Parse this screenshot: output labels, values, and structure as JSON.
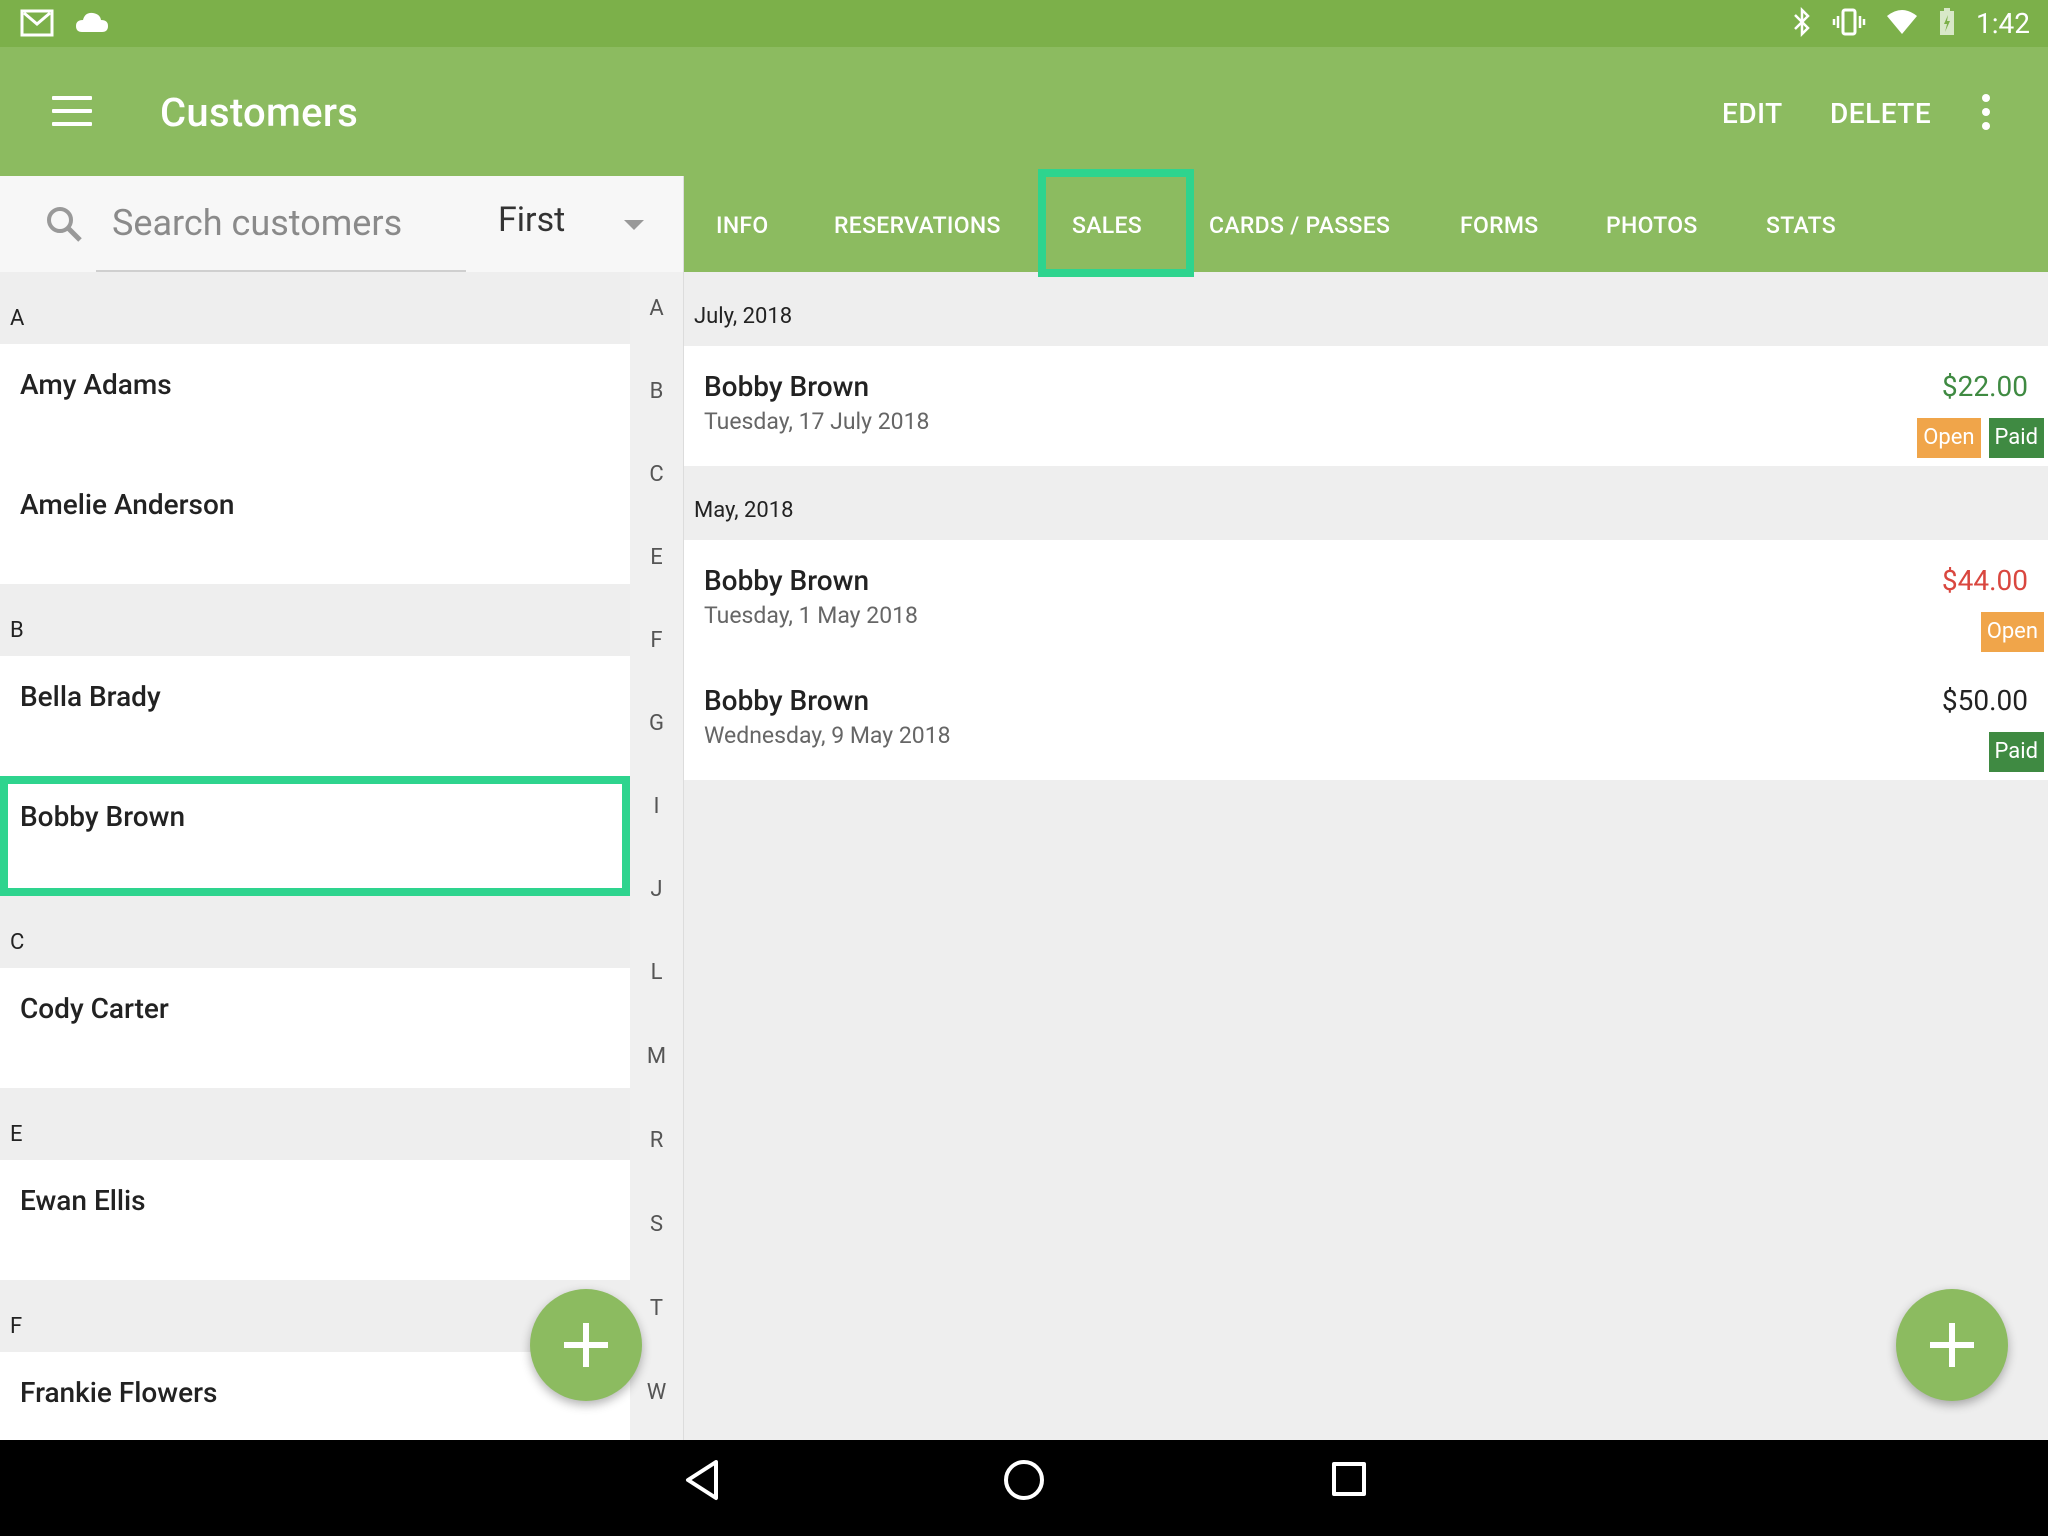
{
  "status_bar": {
    "time": "1:42"
  },
  "app_bar": {
    "title": "Customers",
    "actions": {
      "edit": "EDIT",
      "delete": "DELETE"
    }
  },
  "search": {
    "placeholder": "Search customers",
    "sort_value": "First"
  },
  "customers": {
    "sections": [
      {
        "letter": "A",
        "items": [
          "Amy Adams",
          "Amelie Anderson"
        ]
      },
      {
        "letter": "B",
        "items": [
          "Bella Brady",
          "Bobby Brown"
        ]
      },
      {
        "letter": "C",
        "items": [
          "Cody Carter"
        ]
      },
      {
        "letter": "E",
        "items": [
          "Ewan Ellis"
        ]
      },
      {
        "letter": "F",
        "items": [
          "Frankie Flowers"
        ]
      }
    ],
    "selected": "Bobby Brown"
  },
  "index_letters": [
    "A",
    "B",
    "C",
    "E",
    "F",
    "G",
    "I",
    "J",
    "L",
    "M",
    "R",
    "S",
    "T",
    "W"
  ],
  "tabs": [
    "INFO",
    "RESERVATIONS",
    "SALES",
    "CARDS / PASSES",
    "FORMS",
    "PHOTOS",
    "STATS"
  ],
  "active_tab": "SALES",
  "sales": {
    "groups": [
      {
        "month": "July, 2018",
        "items": [
          {
            "name": "Bobby Brown",
            "date": "Tuesday, 17 July 2018",
            "amount": "$22.00",
            "amount_color": "#3f8a42",
            "badges": [
              "Open",
              "Paid"
            ]
          }
        ]
      },
      {
        "month": "May, 2018",
        "items": [
          {
            "name": "Bobby Brown",
            "date": "Tuesday, 1 May 2018",
            "amount": "$44.00",
            "amount_color": "#d9473f",
            "badges": [
              "Open"
            ]
          },
          {
            "name": "Bobby Brown",
            "date": "Wednesday, 9 May 2018",
            "amount": "$50.00",
            "amount_color": "#222222",
            "badges": [
              "Paid"
            ]
          }
        ]
      }
    ]
  },
  "colors": {
    "primary": "#8cbb60",
    "status_bar": "#7cb04a",
    "highlight": "#2ed48e",
    "open_badge": "#f0a54a",
    "paid_badge": "#3f8a42"
  }
}
